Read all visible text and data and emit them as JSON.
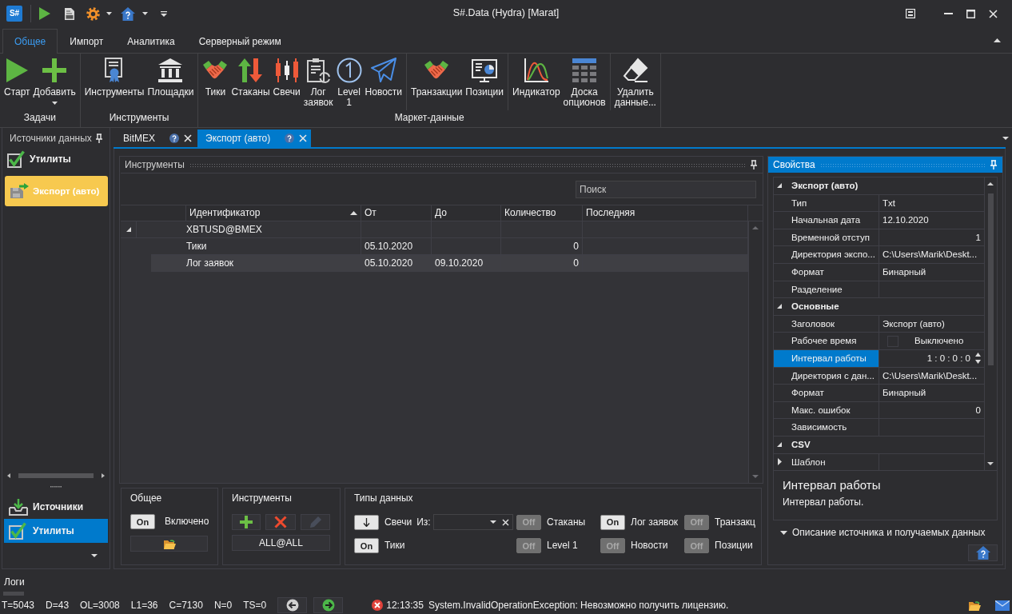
{
  "window": {
    "logo": "S#",
    "title": "S#.Data (Hydra) [Marat]"
  },
  "ribbon": {
    "tabs": [
      {
        "label": "Общее",
        "selected": true
      },
      {
        "label": "Импорт",
        "selected": false
      },
      {
        "label": "Аналитика",
        "selected": false
      },
      {
        "label": "Серверный режим",
        "selected": false
      }
    ],
    "groups": [
      {
        "title": "Задачи",
        "sections": [
          [
            {
              "label": "Старт"
            },
            {
              "label": "Добавить",
              "dropdown": true
            }
          ]
        ]
      },
      {
        "title": "Инструменты",
        "sections": [
          [
            {
              "label": "Инструменты"
            },
            {
              "label": "Площадки"
            }
          ]
        ]
      },
      {
        "title": "Маркет-данные",
        "sections": [
          [
            {
              "label": "Тики"
            },
            {
              "label": "Стаканы"
            },
            {
              "label": "Свечи"
            },
            {
              "label": "Лог заявок"
            },
            {
              "label": "Level 1"
            },
            {
              "label": "Новости"
            }
          ],
          [
            {
              "label": "Транзакции"
            },
            {
              "label": "Позиции"
            }
          ],
          [
            {
              "label": "Индикатор"
            },
            {
              "label": "Доска опционов"
            }
          ],
          [
            {
              "label": "Удалить данные..."
            }
          ]
        ]
      }
    ]
  },
  "sidebar": {
    "title": "Источники данных",
    "group": "Утилиты",
    "items": [
      {
        "label": "Экспорт (авто)",
        "selected": true
      }
    ],
    "nav": [
      {
        "label": "Источники",
        "selected": false
      },
      {
        "label": "Утилиты",
        "selected": true
      }
    ]
  },
  "documents": {
    "tabs": [
      {
        "label": "BitMEX",
        "selected": false
      },
      {
        "label": "Экспорт (авто)",
        "selected": true
      }
    ]
  },
  "instruments": {
    "title": "Инструменты",
    "search": {
      "placeholder": "Поиск"
    },
    "columns": [
      {
        "label": "Идентификатор",
        "sorted": true
      },
      {
        "label": "От",
        "sorted": false
      },
      {
        "label": "До",
        "sorted": false
      },
      {
        "label": "Количество",
        "sorted": false
      },
      {
        "label": "Последняя",
        "sorted": false
      }
    ],
    "rows": [
      {
        "identifier": "XBTUSD@BMEX",
        "expanded": true,
        "selected": false,
        "children": [
          {
            "identifier": "Тики",
            "from": "05.10.2020",
            "count": "0",
            "selected": false
          },
          {
            "identifier": "Лог заявок",
            "from": "05.10.2020",
            "to": "09.10.2020",
            "count": "0",
            "selected": true
          }
        ]
      }
    ]
  },
  "settings": {
    "general": {
      "title": "Общее",
      "toggle": {
        "on": true,
        "text": "On"
      },
      "label": "Включено"
    },
    "instruments": {
      "title": "Инструменты",
      "buttons": [
        {
          "disabled": false
        },
        {
          "disabled": false
        },
        {
          "disabled": true
        }
      ],
      "selection": "ALL@ALL"
    },
    "data_types": {
      "title": "Типы данных",
      "items": [
        {
          "kind": "candles",
          "label": "Свечи",
          "source_label": "Из:"
        },
        {
          "kind": "toggle",
          "label": "Стаканы",
          "on": false,
          "text": "Off"
        },
        {
          "kind": "toggle",
          "label": "Лог заявок",
          "on": true,
          "text": "On"
        },
        {
          "kind": "toggle",
          "label": "Транзакц",
          "on": false,
          "text": "Off"
        },
        {
          "kind": "toggle",
          "label": "Тики",
          "on": true,
          "text": "On"
        },
        {
          "kind": "toggle",
          "label": "Level 1",
          "on": false,
          "text": "Off"
        },
        {
          "kind": "toggle",
          "label": "Новости",
          "on": false,
          "text": "Off"
        },
        {
          "kind": "toggle",
          "label": "Позиции",
          "on": false,
          "text": "Off"
        }
      ]
    }
  },
  "properties": {
    "title": "Свойства",
    "categories": [
      {
        "label": "Экспорт (авто)",
        "expanded": true,
        "rows": [
          {
            "name": "Тип",
            "kind": "text",
            "value": "Txt",
            "selected": false
          },
          {
            "name": "Начальная дата",
            "kind": "text",
            "value": "12.10.2020",
            "selected": false
          },
          {
            "name": "Временной отступ",
            "kind": "number",
            "value": "1",
            "selected": false
          },
          {
            "name": "Директория экспо...",
            "kind": "text",
            "value": "C:\\Users\\Marik\\Deskt...",
            "selected": false
          },
          {
            "name": "Формат",
            "kind": "text",
            "value": "Бинарный",
            "selected": false
          },
          {
            "name": "Разделение",
            "kind": "text",
            "selected": false
          }
        ]
      },
      {
        "label": "Основные",
        "expanded": true,
        "rows": [
          {
            "name": "Заголовок",
            "kind": "text",
            "value": "Экспорт (авто)",
            "selected": false
          },
          {
            "name": "Рабочее время",
            "kind": "checkbox",
            "checked": false,
            "value": "Выключено",
            "selected": false
          },
          {
            "name": "Интервал работы",
            "kind": "spin",
            "value": "1 : 0 : 0 : 0",
            "selected": true
          },
          {
            "name": "Директория с дан...",
            "kind": "text",
            "value": "C:\\Users\\Marik\\Deskt...",
            "selected": false
          },
          {
            "name": "Формат",
            "kind": "text",
            "value": "Бинарный",
            "selected": false
          },
          {
            "name": "Макс. ошибок",
            "kind": "number",
            "value": "0",
            "selected": false
          },
          {
            "name": "Зависимость",
            "kind": "text",
            "selected": false
          }
        ]
      },
      {
        "label": "CSV",
        "expanded": true,
        "rows": [
          {
            "name": "Шаблон",
            "kind": "text",
            "expanded": false,
            "selected": false
          }
        ]
      }
    ],
    "description": {
      "title": "Интервал работы",
      "text": "Интервал работы."
    },
    "footer": "Описание источника и получаемых данных"
  },
  "logs": {
    "title": "Логи"
  },
  "status_bar": {
    "counters": [
      "T=5043",
      "D=43",
      "OL=3008",
      "L1=36",
      "C=7130",
      "N=0",
      "TS=0"
    ],
    "message": {
      "time": "12:13:35",
      "text": "System.InvalidOperationException: Невозможно получить лицензию."
    }
  }
}
